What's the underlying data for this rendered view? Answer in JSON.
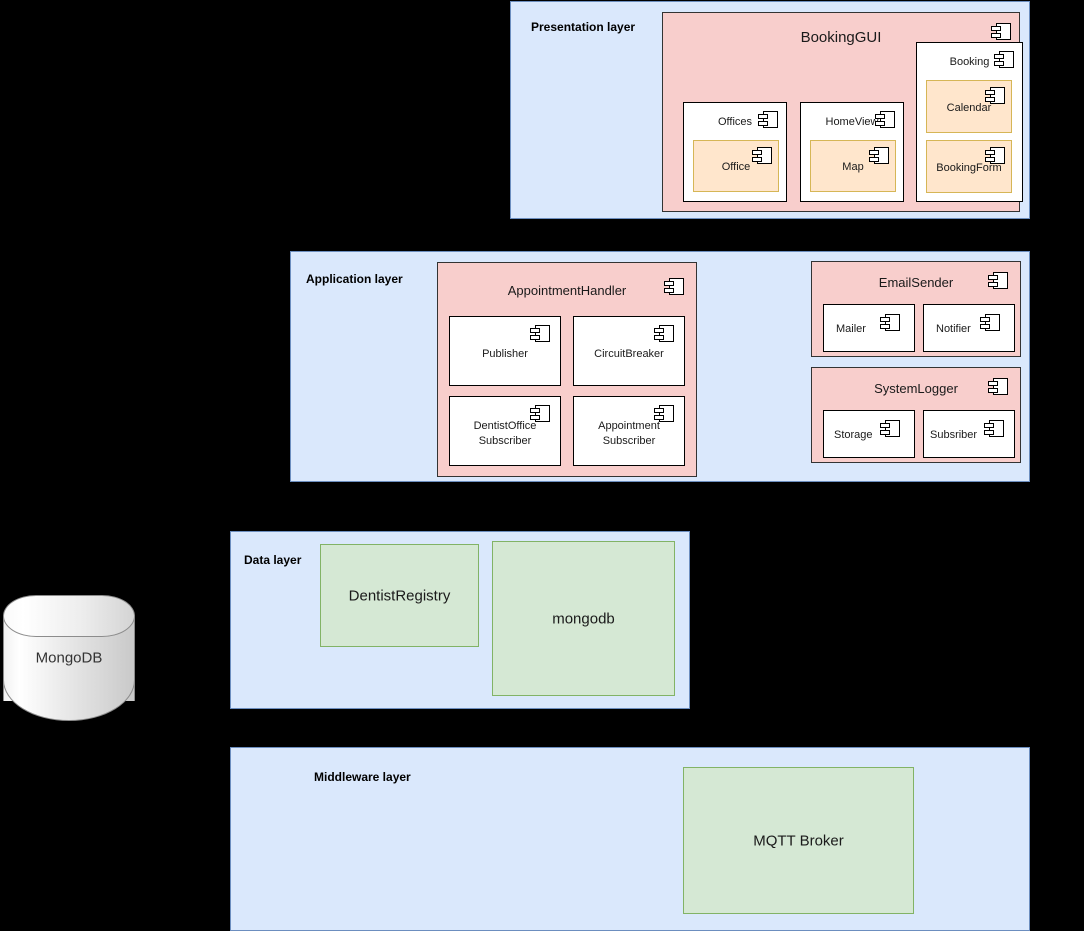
{
  "diagram": {
    "title": "Layered component diagram",
    "colors": {
      "layer_fill": "#dae8fc",
      "layer_stroke": "#6c8ebf",
      "component_fill": "#f8cecc",
      "component_stroke": "#333333",
      "subcomponent_fill": "#ffffff",
      "subcomponent_stroke": "#000000",
      "leaf_fill": "#ffe6cc",
      "leaf_stroke": "#d6b656",
      "node_fill": "#d5e8d4",
      "node_stroke": "#82b366",
      "connector": "#000000",
      "background": "#000000"
    }
  },
  "layers": [
    {
      "id": "presentation",
      "label": "Presentation layer"
    },
    {
      "id": "application",
      "label": "Application layer"
    },
    {
      "id": "data",
      "label": "Data layer"
    },
    {
      "id": "middleware",
      "label": "Middleware layer"
    }
  ],
  "presentation": {
    "label": "Presentation layer",
    "components": {
      "bookinggui": {
        "label": "BookingGUI",
        "children": [
          {
            "label": "Offices",
            "child": {
              "label": "Office"
            }
          },
          {
            "label": "HomeView",
            "child": {
              "label": "Map"
            }
          },
          {
            "label": "Booking",
            "children": [
              {
                "label": "Calendar"
              },
              {
                "label": "BookingForm"
              }
            ]
          }
        ]
      }
    }
  },
  "application": {
    "label": "Application layer",
    "components": {
      "appointmenthandler": {
        "label": "AppointmentHandler",
        "children": [
          {
            "label": "Publisher"
          },
          {
            "label": "CircuitBreaker"
          },
          {
            "label": "DentistOffice Subscriber",
            "line1": "DentistOffice",
            "line2": "Subscriber"
          },
          {
            "label": "Appointment Subscriber",
            "line1": "Appointment",
            "line2": "Subscriber"
          }
        ]
      },
      "emailsender": {
        "label": "EmailSender",
        "children": [
          {
            "label": "Mailer"
          },
          {
            "label": "Notifier"
          }
        ]
      },
      "systemlogger": {
        "label": "SystemLogger",
        "children": [
          {
            "label": "Storage"
          },
          {
            "label": "Subsriber"
          }
        ]
      }
    }
  },
  "data": {
    "label": "Data layer",
    "nodes": [
      {
        "label": "DentistRegistry"
      },
      {
        "label": "mongodb"
      }
    ]
  },
  "middleware": {
    "label": "Middleware layer",
    "nodes": [
      {
        "label": "MQTT Broker"
      }
    ]
  },
  "external": {
    "database": {
      "label": "MongoDB",
      "shape": "cylinder"
    }
  },
  "icons": {
    "component": "uml-component-icon"
  }
}
